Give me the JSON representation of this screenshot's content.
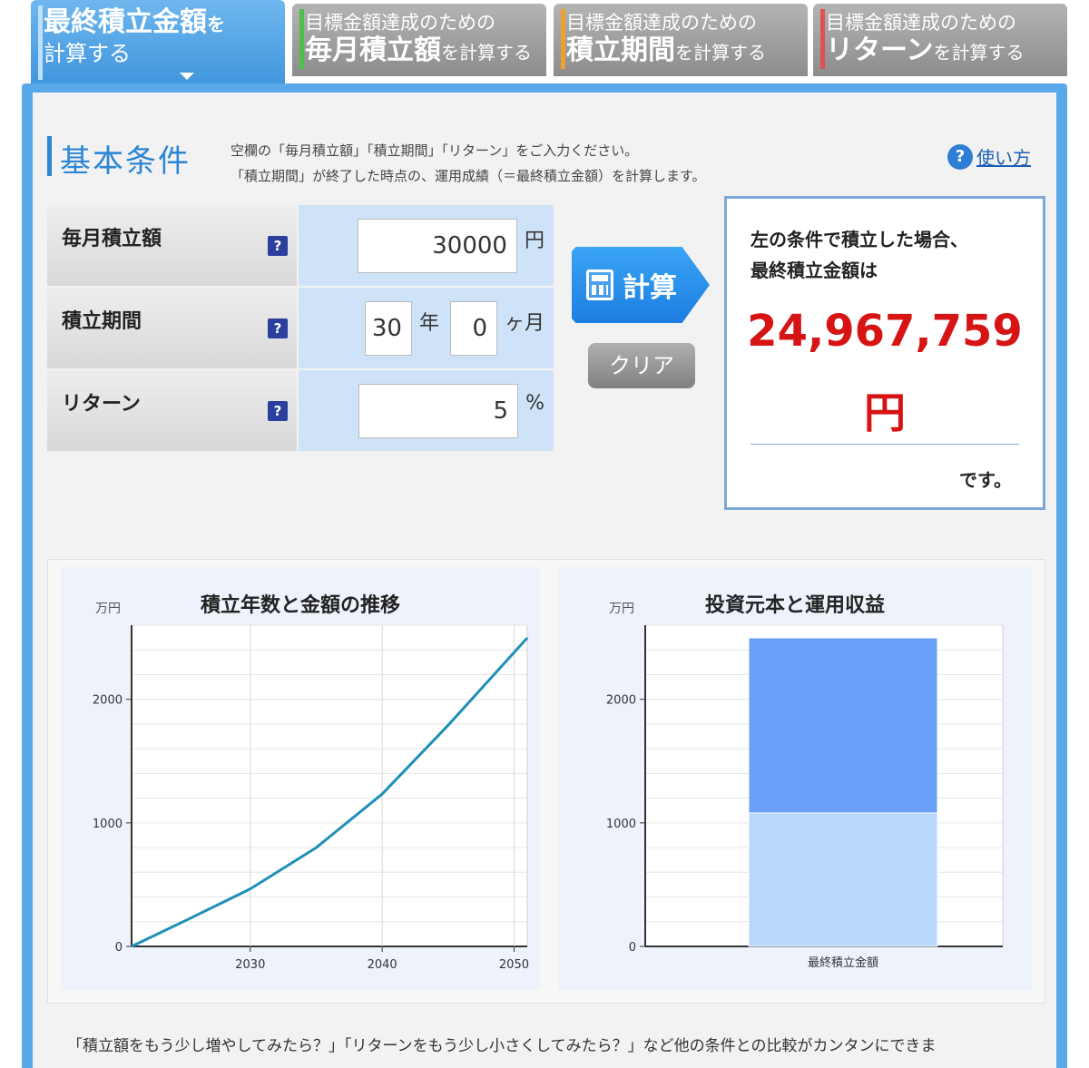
{
  "tabs": [
    {
      "small": "最終積立金額を",
      "line2": "計算する",
      "active": true
    },
    {
      "small": "目標金額達成のための",
      "big": "毎月積立額",
      "suffix": "を計算する",
      "color": "#4cc04c"
    },
    {
      "small": "目標金額達成のための",
      "big": "積立期間",
      "suffix": "を計算する",
      "color": "#f0a030"
    },
    {
      "small": "目標金額達成のための",
      "big": "リターン",
      "suffix": "を計算する",
      "color": "#e05050"
    }
  ],
  "active_tab": {
    "big": "最終積立金額",
    "suffix": "を",
    "line2": "計算する"
  },
  "heading": "基本条件",
  "description": {
    "line1": "空欄の「毎月積立額」「積立期間」「リターン」をご入力ください。",
    "line2": "「積立期間」が終了した時点の、運用成績（＝最終積立金額）を計算します。"
  },
  "help": {
    "icon": "?",
    "label": "使い方"
  },
  "conditions": {
    "monthly": {
      "label": "毎月積立額",
      "value": "30000",
      "unit": "円"
    },
    "period": {
      "label": "積立期間",
      "years": "30",
      "years_unit": "年",
      "months": "0",
      "months_unit": "ヶ月"
    },
    "return": {
      "label": "リターン",
      "value": "5",
      "unit": "%"
    }
  },
  "buttons": {
    "calc": "計算",
    "clear": "クリア"
  },
  "result": {
    "lead1": "左の条件で積立した場合、",
    "lead2": "最終積立金額は",
    "amount": "24,967,759",
    "yen": "円",
    "tail": "です。"
  },
  "footer": "「積立額をもう少し増やしてみたら？」「リターンをもう少し小さくしてみたら？」など他の条件との比較がカンタンにできま",
  "chart_data": [
    {
      "type": "line",
      "title": "積立年数と金額の推移",
      "ylabel": "万円",
      "x": [
        2021,
        2025,
        2030,
        2035,
        2040,
        2045,
        2051
      ],
      "values": [
        0,
        204,
        466,
        800,
        1233,
        1790,
        2497
      ],
      "xticks": [
        2030,
        2040,
        2050
      ],
      "yticks": [
        0,
        1000,
        2000
      ],
      "xlim": [
        2021,
        2051
      ],
      "ylim": [
        0,
        2600
      ],
      "color": "#1f8fb8"
    },
    {
      "type": "bar",
      "title": "投資元本と運用収益",
      "ylabel": "万円",
      "categories": [
        "最終積立金額"
      ],
      "series": [
        {
          "values": [
            1080
          ],
          "color": "#b9d6fb"
        },
        {
          "values": [
            1417
          ],
          "color": "#6a9ff7"
        }
      ],
      "yticks": [
        0,
        1000,
        2000
      ],
      "ylim": [
        0,
        2600
      ]
    }
  ]
}
